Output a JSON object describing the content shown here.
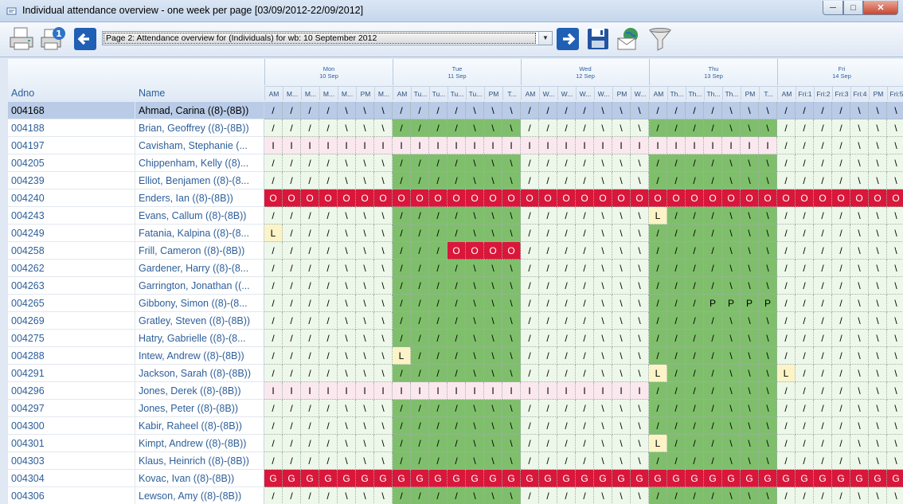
{
  "window": {
    "title": "Individual attendance overview - one week per page [03/09/2012-22/09/2012]"
  },
  "toolbar": {
    "page_selected": "Page 2: Attendance overview for (Individuals) for wb: 10 September 2012",
    "icons": [
      "printer-icon",
      "print-one-icon",
      "previous-page-icon",
      "next-page-icon",
      "save-icon",
      "email-icon",
      "filter-icon"
    ]
  },
  "columns": {
    "adno": "Adno",
    "name": "Name"
  },
  "days": [
    {
      "day": "Mon",
      "date": "10 Sep",
      "periods": [
        "AM",
        "M...",
        "M...",
        "M...",
        "M...",
        "PM",
        "M..."
      ]
    },
    {
      "day": "Tue",
      "date": "11 Sep",
      "periods": [
        "AM",
        "Tu...",
        "Tu...",
        "Tu...",
        "Tu...",
        "PM",
        "T..."
      ]
    },
    {
      "day": "Wed",
      "date": "12 Sep",
      "periods": [
        "AM",
        "W...",
        "W...",
        "W...",
        "W...",
        "PM",
        "W..."
      ]
    },
    {
      "day": "Thu",
      "date": "13 Sep",
      "periods": [
        "AM",
        "Th...",
        "Th...",
        "Th...",
        "Th...",
        "PM",
        "T..."
      ]
    },
    {
      "day": "Fri",
      "date": "14 Sep",
      "periods": [
        "AM",
        "Fri:1",
        "Fri:2",
        "Fri:3",
        "Fri:4",
        "PM",
        "Fri:5"
      ]
    }
  ],
  "colors": {
    "green_light": "#eef8ea",
    "green_dark": "#7fbf6c",
    "absent_red": "#d9173a",
    "late_yellow": "#fcf4c6",
    "pink": "#fbe8ef",
    "selected": "#b9cbe7"
  },
  "rows": [
    {
      "adno": "004168",
      "name": "Ahmad, Carina ((8)-(8B))",
      "marks": "///\\\\\\\\///\\\\\\\\///\\\\\\\\///\\\\\\\\///\\\\\\\\"
    },
    {
      "adno": "004188",
      "name": "Brian, Geoffrey ((8)-(8B))",
      "marks": ""
    },
    {
      "adno": "004197",
      "name": "Cavisham, Stephanie (...",
      "marks": "IIIIIIIIIIIIIIIIIIIIIIIIIIII/"
    },
    {
      "adno": "004205",
      "name": "Chippenham, Kelly ((8)...",
      "marks": ""
    },
    {
      "adno": "004239",
      "name": "Elliot, Benjamen ((8)-(8...",
      "marks": ""
    },
    {
      "adno": "004240",
      "name": "Enders, Ian ((8)-(8B))",
      "marks": "OOOOOOOOOOOOOOOOOOOOOOOOOOOOOOOOOOO"
    },
    {
      "adno": "004243",
      "name": "Evans, Callum ((8)-(8B))",
      "marks": "L@21"
    },
    {
      "adno": "004249",
      "name": "Fatania, Kalpina ((8)-(8...",
      "marks": "L@0"
    },
    {
      "adno": "004258",
      "name": "Frill, Cameron ((8)-(8B))",
      "marks": "OOOO@10"
    },
    {
      "adno": "004262",
      "name": "Gardener, Harry ((8)-(8...",
      "marks": ""
    },
    {
      "adno": "004263",
      "name": "Garrington, Jonathan ((...",
      "marks": ""
    },
    {
      "adno": "004265",
      "name": "Gibbony, Simon ((8)-(8...",
      "marks": "PPPP@24"
    },
    {
      "adno": "004269",
      "name": "Gratley, Steven ((8)-(8B))",
      "marks": ""
    },
    {
      "adno": "004275",
      "name": "Hatry, Gabrielle ((8)-(8...",
      "marks": ""
    },
    {
      "adno": "004288",
      "name": "Intew, Andrew ((8)-(8B))",
      "marks": "L@7"
    },
    {
      "adno": "004291",
      "name": "Jackson, Sarah ((8)-(8B))",
      "marks": "L@21,L@28"
    },
    {
      "adno": "004296",
      "name": "Jones, Derek ((8)-(8B))",
      "marks": "IIIIIIIIIIIIIIIIIIIII"
    },
    {
      "adno": "004297",
      "name": "Jones, Peter ((8)-(8B))",
      "marks": ""
    },
    {
      "adno": "004300",
      "name": "Kabir, Raheel ((8)-(8B))",
      "marks": ""
    },
    {
      "adno": "004301",
      "name": "Kimpt, Andrew ((8)-(8B))",
      "marks": "L@21"
    },
    {
      "adno": "004303",
      "name": "Klaus, Heinrich ((8)-(8B))",
      "marks": ""
    },
    {
      "adno": "004304",
      "name": "Kovac, Ivan ((8)-(8B))",
      "marks": "GGGGGGGGGGGGGGGGGGGGGGGGGGGGGGGGGGG"
    },
    {
      "adno": "004306",
      "name": "Lewson, Amy ((8)-(8B))",
      "marks": ""
    }
  ]
}
